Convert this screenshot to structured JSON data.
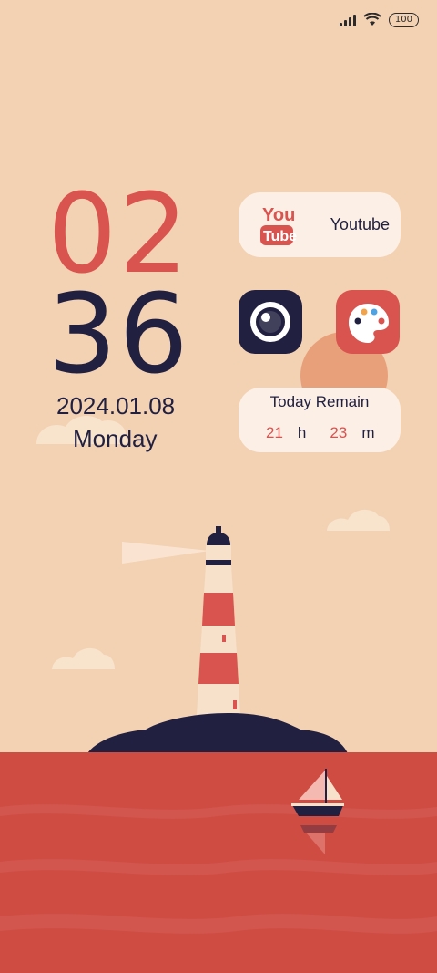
{
  "status_bar": {
    "battery_label": "100",
    "icons": [
      "signal-icon",
      "wifi-icon",
      "battery-icon"
    ]
  },
  "clock": {
    "hour": "02",
    "minute": "36",
    "date": "2024.01.08",
    "weekday": "Monday"
  },
  "widgets": {
    "youtube": {
      "logo_top": "You",
      "logo_bottom": "Tube",
      "label": "Youtube"
    },
    "remain": {
      "title": "Today Remain",
      "hours": "21",
      "hours_unit": "h",
      "minutes": "23",
      "minutes_unit": "m"
    }
  },
  "apps": [
    {
      "name": "camera-app",
      "icon": "camera-icon"
    },
    {
      "name": "palette-app",
      "icon": "palette-icon"
    }
  ],
  "colors": {
    "background": "#f3d2b3",
    "accent_red": "#d9534f",
    "navy": "#222040",
    "widget_bg": "#fcefe6",
    "sea": "#cf4c43",
    "sun": "#e8a07a"
  }
}
